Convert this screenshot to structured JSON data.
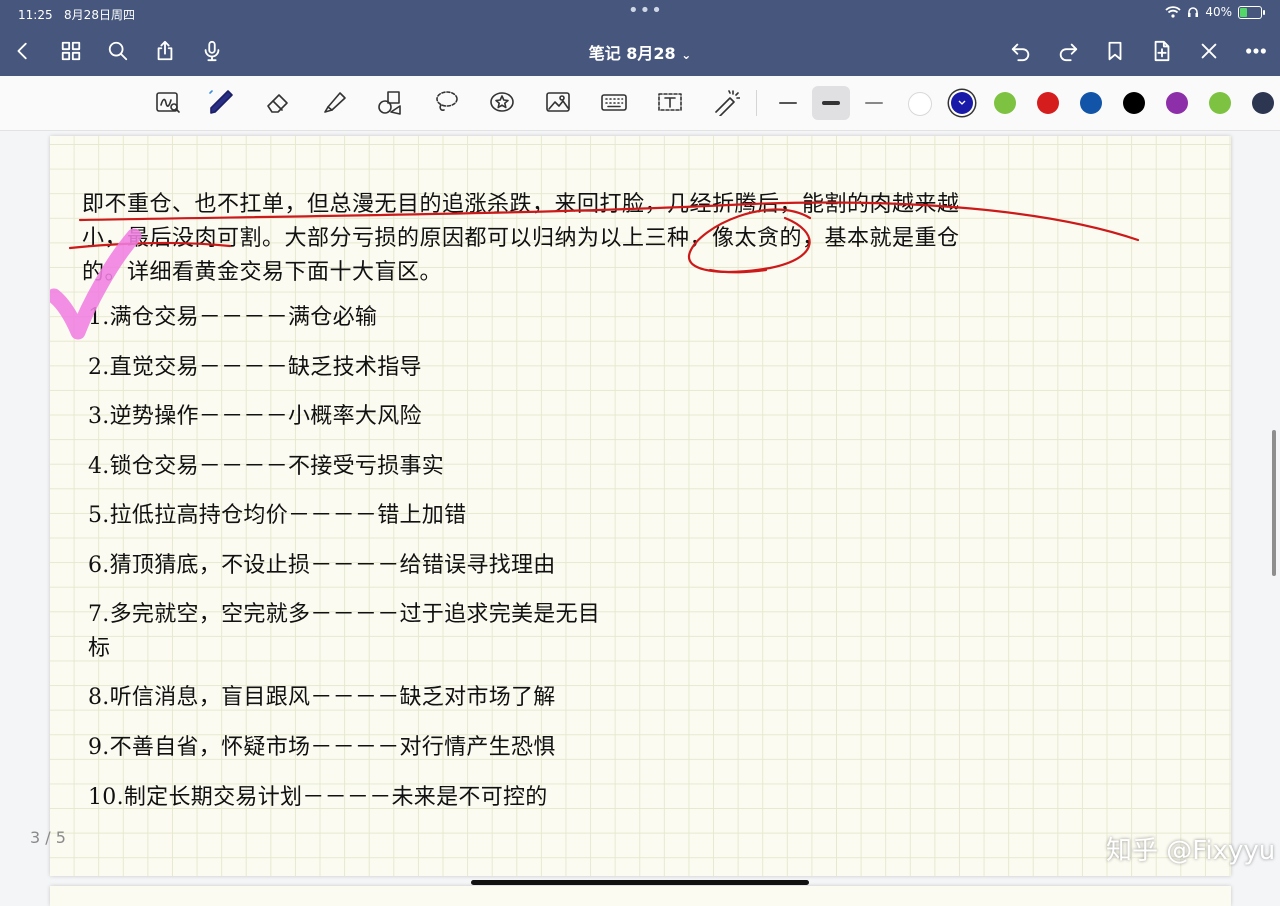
{
  "status": {
    "time": "11:25",
    "date": "8月28日周四",
    "battery_pct": "40%",
    "battery_level": 0.4
  },
  "header": {
    "title": "笔记 8月28",
    "chevron": "⌄"
  },
  "icons": {
    "back": "chevron-left-icon",
    "grid": "grid-icon",
    "search": "search-icon",
    "share": "share-icon",
    "mic": "microphone-icon",
    "undo": "undo-icon",
    "redo": "redo-icon",
    "bookmark": "bookmark-icon",
    "add_page": "add-page-icon",
    "close": "close-icon",
    "more": "more-icon"
  },
  "tools": [
    "handwriting-recognition",
    "pen",
    "eraser",
    "highlighter",
    "shapes",
    "lasso",
    "sticker",
    "image",
    "keyboard",
    "text",
    "laser-pointer"
  ],
  "colors": {
    "chrome": "#46567c",
    "swatches": [
      "#ffffff",
      "#1a1aa8",
      "#7ec242",
      "#d61d1d",
      "#1254a8",
      "#000000",
      "#8d2fa8",
      "#7ec242",
      "#2c3650"
    ],
    "selected_swatch": 1,
    "red_ink": "#cc1a1a",
    "pink_ink": "#f07ee0"
  },
  "note": {
    "intro": [
      "即不重仓、也不扛单，但总漫无目的追涨杀跌，来回打脸，几经折腾后，能割的肉越来越",
      "小，最后没肉可割。大部分亏损的原因都可以归纳为以上三种，像太贪的，基本就是重仓",
      "的。详细看黄金交易下面十大盲区。"
    ],
    "items": [
      "1.满仓交易－－－－满仓必输",
      "2.直觉交易－－－－缺乏技术指导",
      "3.逆势操作－－－－小概率大风险",
      "4.锁仓交易－－－－不接受亏损事实",
      "5.拉低拉高持仓均价－－－－错上加错",
      "6.猜顶猜底，不设止损－－－－给错误寻找理由",
      "7.多完就空，空完就多－－－－过于追求完美是无目",
      "标",
      "8.听信消息，盲目跟风－－－－缺乏对市场了解",
      "9.不善自省，怀疑市场－－－－对行情产生恐惧",
      "10.制定长期交易计划－－－－未来是不可控的"
    ]
  },
  "page_indicator": "3 / 5",
  "watermark": "知乎 @Fixyyu"
}
